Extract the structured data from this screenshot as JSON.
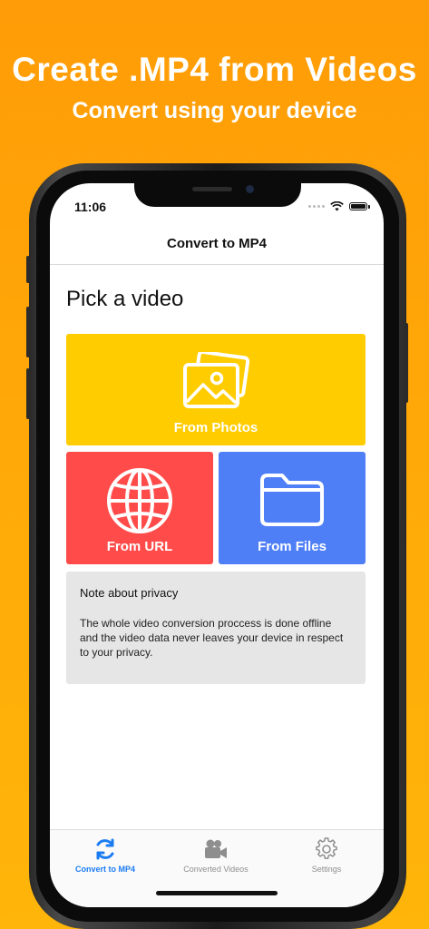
{
  "promo": {
    "headline": "Create .MP4 from Videos",
    "subline": "Convert using your device"
  },
  "status_bar": {
    "time": "11:06"
  },
  "nav": {
    "title": "Convert to MP4"
  },
  "main": {
    "section_title": "Pick a video",
    "tiles": {
      "photos": {
        "label": "From Photos",
        "icon": "photos-icon",
        "color": "#ffcc00"
      },
      "url": {
        "label": "From URL",
        "icon": "globe-icon",
        "color": "#ff4c4a"
      },
      "files": {
        "label": "From Files",
        "icon": "folder-icon",
        "color": "#4f7ff6"
      }
    },
    "privacy": {
      "title": "Note about privacy",
      "body": "The whole video conversion proccess is done offline and the video data never leaves your device in respect to your privacy."
    }
  },
  "tabbar": {
    "accent": "#1b7cf2",
    "tabs": [
      {
        "label": "Convert to MP4",
        "icon": "convert-icon",
        "active": true
      },
      {
        "label": "Converted Videos",
        "icon": "video-camera-icon",
        "active": false
      },
      {
        "label": "Settings",
        "icon": "gear-icon",
        "active": false
      }
    ]
  }
}
